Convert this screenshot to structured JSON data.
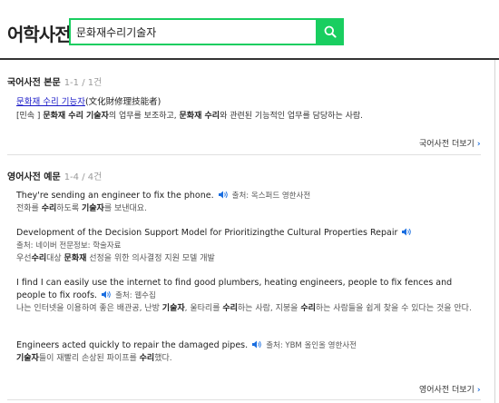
{
  "header": {
    "logo": "어학사전",
    "search_value": "문화재수리기술자"
  },
  "korean": {
    "title": "국어사전 본문",
    "count": "1-1 / 1건",
    "entry_word": "문화재 수리 기능자",
    "entry_hanja": "(文化財修理技能者)",
    "def_tag": "[민속 ]",
    "def_parts": [
      "문화재 수리 기술자",
      "의 업무를 보조하고, ",
      "문화재 수리",
      "와 관련된 기능적인 업무를 담당하는 사람."
    ],
    "more": "국어사전 더보기"
  },
  "english": {
    "title": "영어사전 예문",
    "count": "1-4 / 4건",
    "examples": [
      {
        "en": "They're sending an engineer to fix the phone.",
        "source": "출처: 옥스퍼드 영한사전",
        "ko_parts": [
          "전화를 ",
          "수리",
          "하도록 ",
          "기술자",
          "를 보낸대요."
        ]
      },
      {
        "en": "Development of the Decision Support Model for Prioritizingthe Cultural Properties Repair",
        "source": "출처: 네이버 전문정보: 학술자료",
        "ko_parts": [
          "우선",
          "수리",
          "대상 ",
          "문화재",
          " 선정을 위한 의사결정 지원 모델 개발"
        ]
      },
      {
        "en": "I find I can easily use the internet to find good plumbers, heating engineers, people to fix fences and people to fix roofs.",
        "source": "출처: 웹수집",
        "ko_parts": [
          "나는 인터넷을 이용하여 좋은 배관공, 난방 ",
          "기술자",
          ", 울타리를 ",
          "수리",
          "하는 사람, 지붕을 ",
          "수리",
          "하는 사람들을 쉽게 찾을 수 있다는 것을 안다."
        ]
      },
      {
        "en": "Engineers acted quickly to repair the damaged pipes.",
        "source": "출처: YBM 올인올 영한사전",
        "ko_parts": [
          "기술자",
          "들이 재빨리 손상된 파이프를 ",
          "수리",
          "했다."
        ]
      }
    ],
    "more": "영어사전 더보기"
  },
  "colors": {
    "accent": "#19ce60",
    "link": "#1a1ac8",
    "more_chevron": "#1a6ee0"
  }
}
